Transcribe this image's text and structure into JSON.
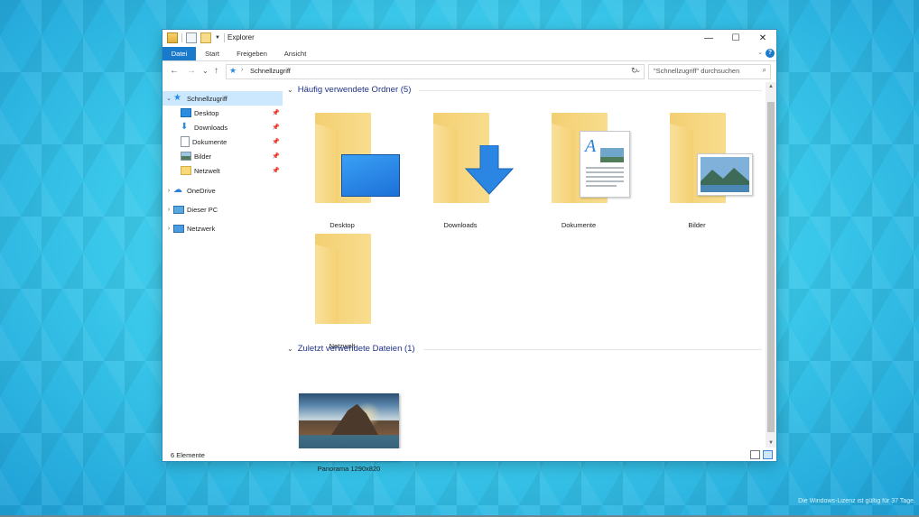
{
  "window": {
    "title": "Explorer",
    "buttons": {
      "minimize": "—",
      "maximize": "☐",
      "close": "✕"
    }
  },
  "ribbon": {
    "tabs": [
      "Datei",
      "Start",
      "Freigeben",
      "Ansicht"
    ],
    "expand": "⌄",
    "help": "?"
  },
  "nav": {
    "back": "←",
    "forward": "→",
    "recent": "⌄",
    "up": "↑",
    "path": "Schnellzugriff",
    "dropdown": "⌄",
    "refresh": "↻",
    "search_placeholder": "\"Schnellzugriff\" durchsuchen"
  },
  "sidebar": {
    "quick": {
      "label": "Schnellzugriff",
      "expanded": "⌄"
    },
    "pinned": [
      {
        "label": "Desktop",
        "icon": "desktop-icon"
      },
      {
        "label": "Downloads",
        "icon": "download-icon"
      },
      {
        "label": "Dokumente",
        "icon": "documents-icon"
      },
      {
        "label": "Bilder",
        "icon": "pictures-icon"
      },
      {
        "label": "Netzwelt",
        "icon": "folder-icon"
      }
    ],
    "roots": [
      {
        "label": "OneDrive",
        "icon": "onedrive-icon"
      },
      {
        "label": "Dieser PC",
        "icon": "pc-icon"
      },
      {
        "label": "Netzwerk",
        "icon": "network-icon"
      }
    ]
  },
  "content": {
    "group1": {
      "title": "Häufig verwendete Ordner (5)"
    },
    "folders": [
      "Desktop",
      "Downloads",
      "Dokumente",
      "Bilder",
      "Netzwelt"
    ],
    "group2": {
      "title": "Zuletzt verwendete Dateien (1)"
    },
    "files": [
      {
        "label": "Panorama 1290x820"
      }
    ]
  },
  "status": {
    "count": "6 Elemente"
  },
  "desktop": {
    "watermark": "Die Windows-Lizenz ist gültig für 37 Tage."
  },
  "colors": {
    "accent": "#1979ca",
    "selection": "#cce8ff",
    "group_title": "#1e3287"
  }
}
